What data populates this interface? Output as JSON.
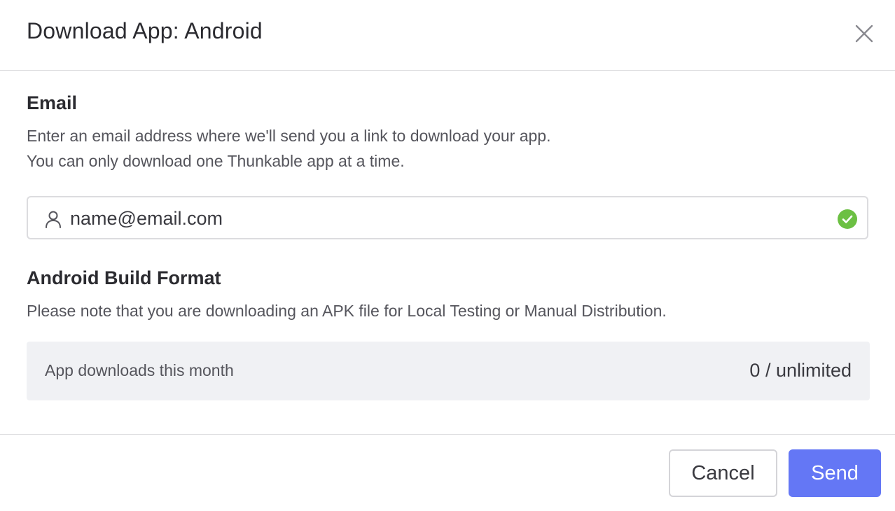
{
  "dialog": {
    "title": "Download App: Android",
    "close_icon": "close-icon"
  },
  "email_section": {
    "title": "Email",
    "description_line1": "Enter an email address where we'll send you a link to download your app.",
    "description_line2": "You can only download one Thunkable app at a time.",
    "input": {
      "value": "name@email.com",
      "leading_icon": "user-icon",
      "trailing_icon": "valid-check-icon",
      "valid": true
    }
  },
  "build_section": {
    "title": "Android Build Format",
    "description": "Please note that you are downloading an APK file for Local Testing or Manual Distribution."
  },
  "usage": {
    "label": "App downloads this month",
    "value": "0 / unlimited"
  },
  "footer": {
    "cancel_label": "Cancel",
    "send_label": "Send"
  },
  "colors": {
    "accent": "#6477f5",
    "valid": "#6cc043",
    "usage_background": "#f0f1f4"
  }
}
